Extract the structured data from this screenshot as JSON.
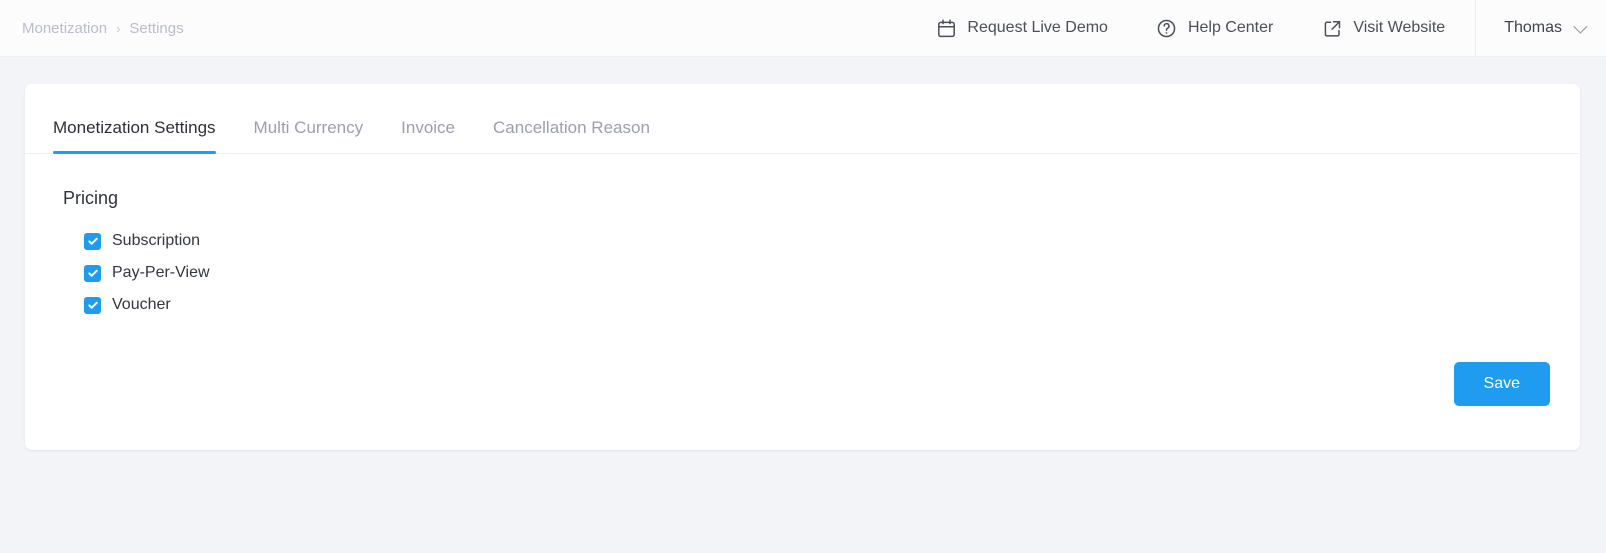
{
  "theme": {
    "accent": "#1f9cf0",
    "page_bg": "#f3f4f8",
    "card_bg": "#ffffff",
    "header_bg": "#fcfcfd",
    "muted_text": "#b9bdc9",
    "body_text": "#32373e"
  },
  "header": {
    "breadcrumb": {
      "items": [
        "Monetization",
        "Settings"
      ],
      "separator": "›"
    },
    "actions": [
      {
        "label": "Request Live Demo",
        "icon": "calendar-icon"
      },
      {
        "label": "Help Center",
        "icon": "question-circle-icon"
      },
      {
        "label": "Visit Website",
        "icon": "external-link-icon"
      }
    ],
    "user": {
      "name": "Thomas",
      "icon": "chevron-down-icon"
    }
  },
  "main": {
    "tabs": [
      {
        "label": "Monetization Settings",
        "active": true
      },
      {
        "label": "Multi Currency",
        "active": false
      },
      {
        "label": "Invoice",
        "active": false
      },
      {
        "label": "Cancellation Reason",
        "active": false
      }
    ],
    "pricing": {
      "title": "Pricing",
      "options": [
        {
          "label": "Subscription",
          "checked": true
        },
        {
          "label": "Pay-Per-View",
          "checked": true
        },
        {
          "label": "Voucher",
          "checked": true
        }
      ]
    },
    "save_label": "Save"
  }
}
